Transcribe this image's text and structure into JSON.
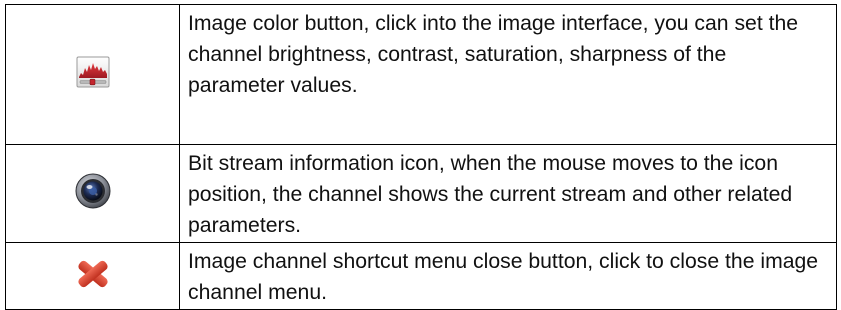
{
  "table": {
    "rows": [
      {
        "icon": "image-color-icon",
        "description": "Image color button, click into the image interface, you can set the channel brightness, contrast, saturation, sharpness of the parameter values."
      },
      {
        "icon": "camera-lens-icon",
        "description": "Bit stream information icon, when the mouse moves to the icon position, the channel shows the current stream and other related parameters."
      },
      {
        "icon": "close-x-icon",
        "description": "Image channel shortcut menu close button, click to close the image channel menu."
      }
    ]
  },
  "colors": {
    "chart_red": "#c4262e",
    "lens_grey": "#6b6f78",
    "close_red": "#d9402f"
  }
}
